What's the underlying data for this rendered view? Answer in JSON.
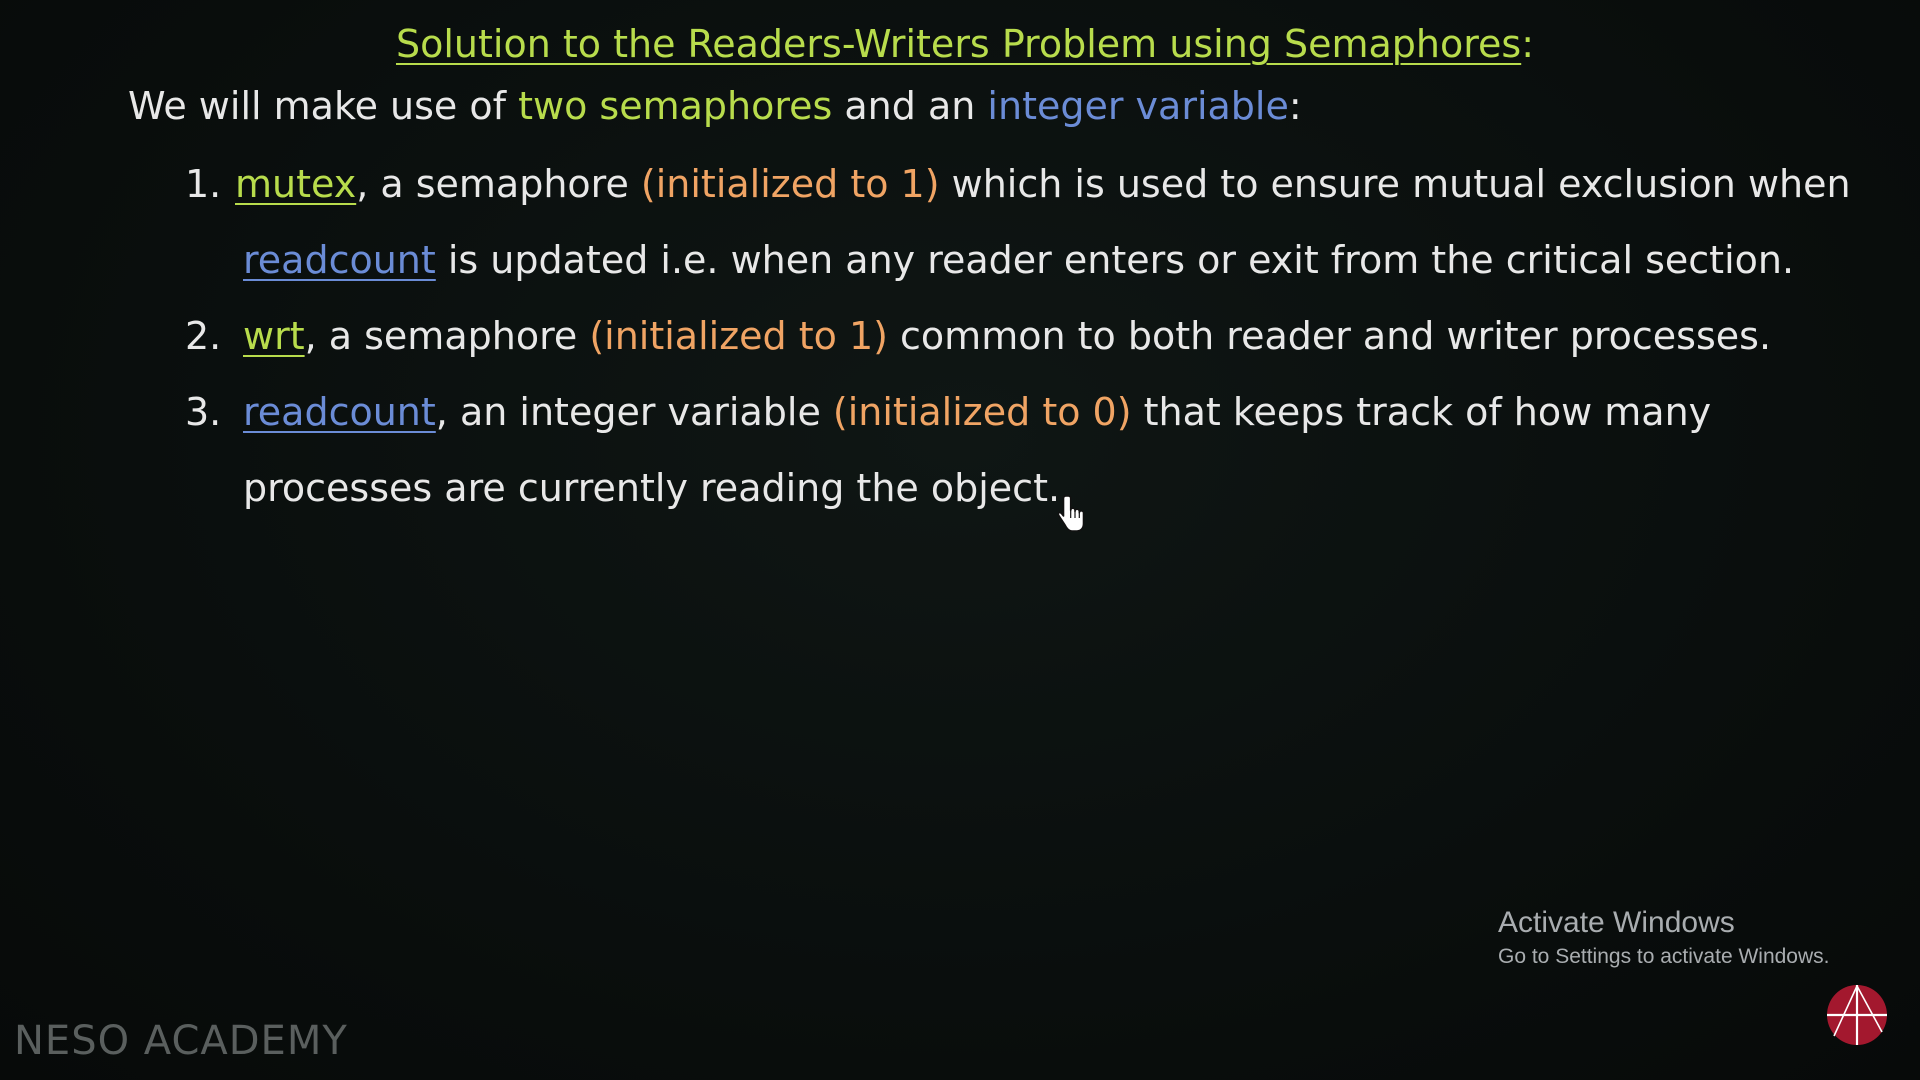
{
  "title": {
    "text": "Solution to the Readers-Writers Problem using Semaphores",
    "suffix": ":"
  },
  "intro": {
    "part1": "We will make use of ",
    "highlight1": "two semaphores",
    "part2": " and an ",
    "highlight2": "integer variable",
    "part3": ":"
  },
  "items": [
    {
      "number": "1.",
      "term": "mutex",
      "after_term": ", a semaphore ",
      "init": "(initialized to 1)",
      "rest": " which is used to ensure mutual exclusion when",
      "line2_term": "readcount",
      "line2_rest": " is updated i.e. when any reader enters or exit from the critical section."
    },
    {
      "number": "2.",
      "term": "wrt",
      "after_term": ", a semaphore ",
      "init": "(initialized to 1)",
      "rest": " common to both reader and writer processes."
    },
    {
      "number": "3.",
      "term": "readcount",
      "after_term": ", an integer variable ",
      "init": "(initialized to 0)",
      "rest": " that keeps track of how many",
      "line2_rest": "processes are currently reading the object."
    }
  ],
  "watermark": {
    "title": "Activate Windows",
    "subtitle": "Go to Settings to activate Windows."
  },
  "brand": "NESO ACADEMY",
  "colors": {
    "green": "#b8dc4c",
    "blue": "#6b8cd6",
    "orange": "#f0a464",
    "text": "#e8e8e8",
    "background": "#0a0f0e",
    "logo": "#a3182e"
  },
  "icons": {
    "cursor": "hand-pointer-icon",
    "logo": "neso-logo-icon"
  }
}
